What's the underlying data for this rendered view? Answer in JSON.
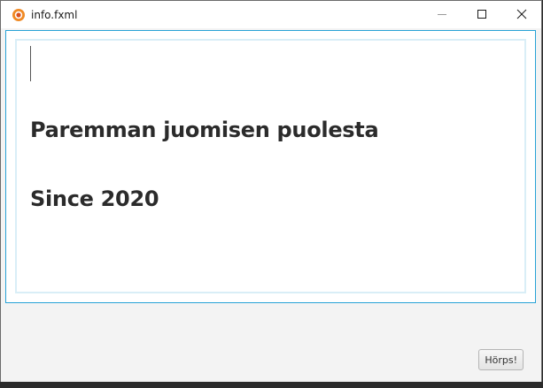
{
  "window": {
    "title": "info.fxml",
    "icon": "app-logo-icon",
    "controls": [
      "minimize-icon",
      "maximize-icon",
      "close-icon"
    ]
  },
  "content": {
    "line1": "Paremman juomisen puolesta",
    "line2": "Since 2020"
  },
  "actions": {
    "button_label": "Hörps!"
  },
  "colors": {
    "focus_border": "#27a2d6",
    "inner_border": "#d9eef7",
    "app_icon": "#f08a24"
  }
}
